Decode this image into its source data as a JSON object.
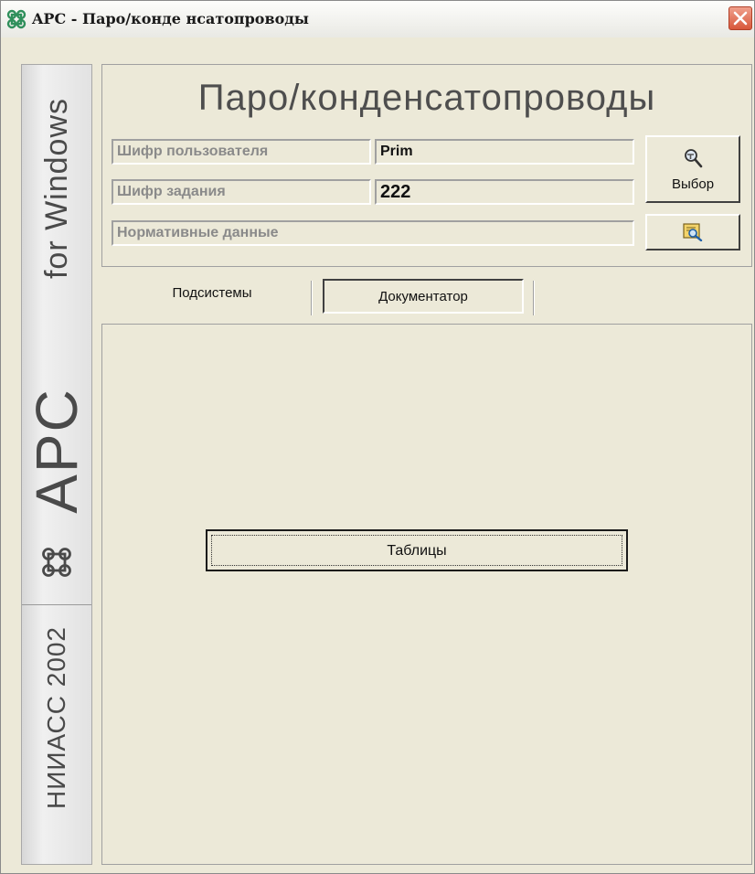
{
  "window": {
    "title_app": "APC",
    "title_separator": " - ",
    "title_module": "Паро/конде нсатопроводы",
    "close_icon": "close-icon"
  },
  "sidebar": {
    "brand_for_windows": "for Windows",
    "brand_apc": "APC",
    "brand_symbol_icon": "command-symbol-icon",
    "brand_org": "НИИАСС 2002"
  },
  "header": {
    "title": "Паро/конденсатопроводы",
    "user_code_label": "Шифр пользователя",
    "user_code_value": "Prim",
    "task_code_label": "Шифр задания",
    "task_code_value": "222",
    "normative_label": "Нормативные данные",
    "select_button_label": "Выбор",
    "select_button_icon": "magnifier-hammer-icon",
    "normative_button_icon": "view-document-icon"
  },
  "tabs": [
    {
      "label": "Подсистемы",
      "active": false
    },
    {
      "label": "Документатор",
      "active": true
    }
  ],
  "content": {
    "tables_button_label": "Таблицы"
  },
  "colors": {
    "panel_background": "#ece9d8",
    "close_button": "#d8573a",
    "label_text": "#8a8a8a"
  }
}
